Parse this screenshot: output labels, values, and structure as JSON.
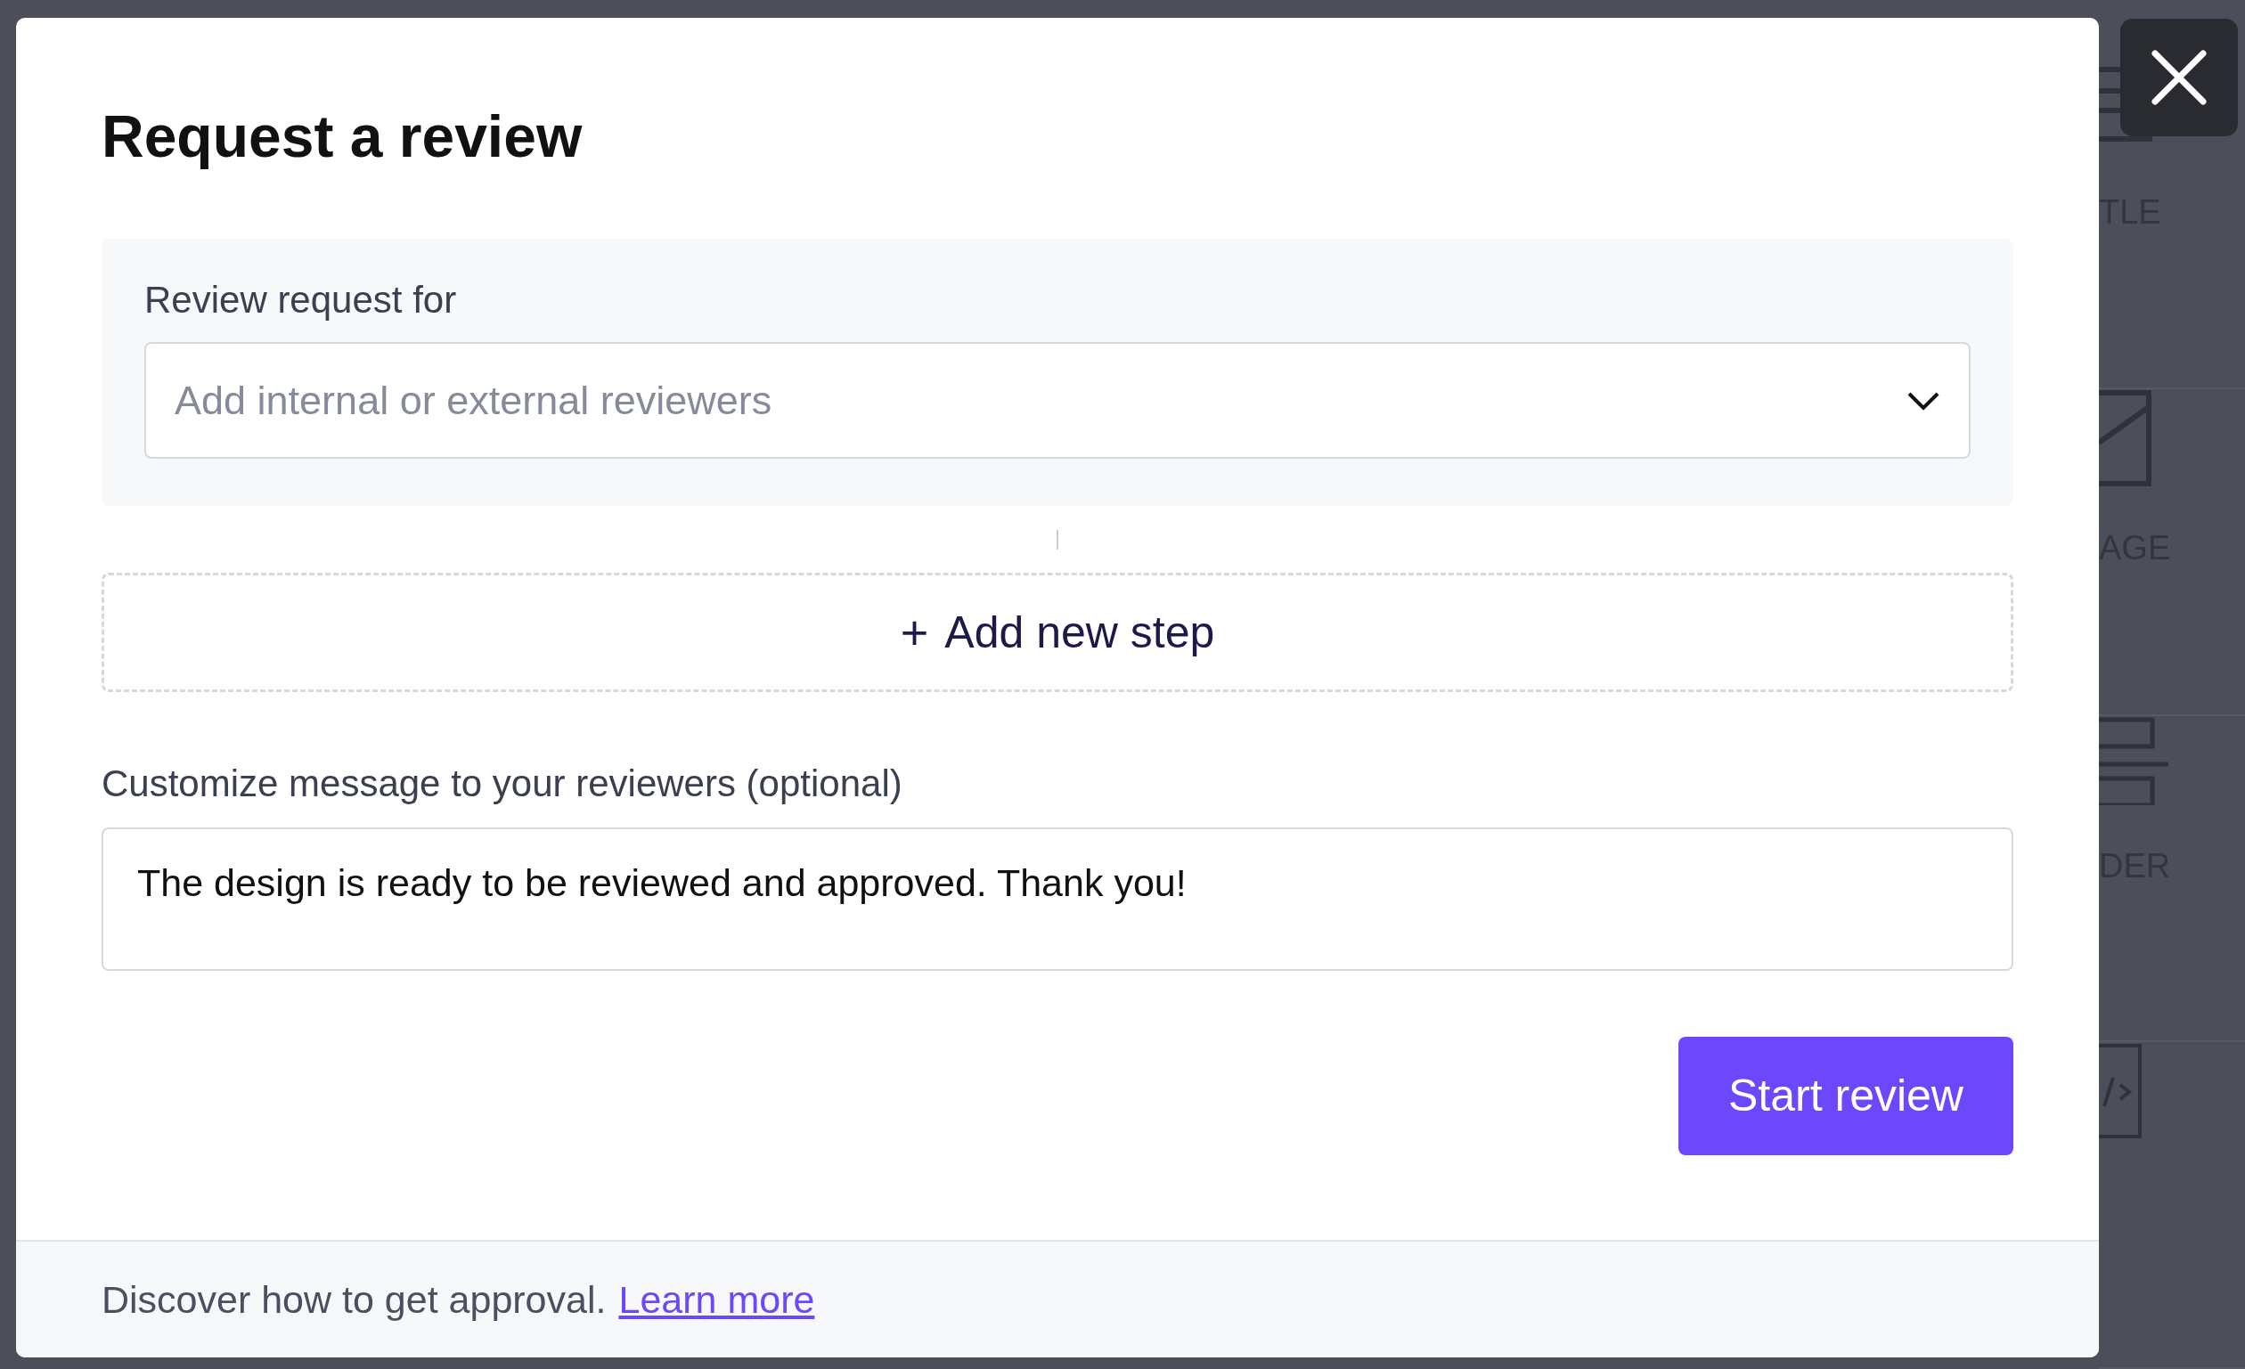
{
  "background_panel": {
    "items": [
      {
        "kind": "lines",
        "label": "TLE"
      },
      {
        "kind": "image",
        "label": "AGE"
      },
      {
        "kind": "divider",
        "label": "DER"
      },
      {
        "kind": "code"
      }
    ]
  },
  "dialog": {
    "title": "Request a review",
    "reviewers": {
      "label": "Review request for",
      "placeholder": "Add internal or external reviewers"
    },
    "add_step": {
      "icon": "+",
      "label": "Add new step"
    },
    "message": {
      "label": "Customize message to your reviewers (optional)",
      "value": "The design is ready to be reviewed and approved. Thank you!"
    },
    "primary_button": "Start review",
    "footer": {
      "text": "Discover how to get approval.",
      "link": "Learn more"
    }
  }
}
